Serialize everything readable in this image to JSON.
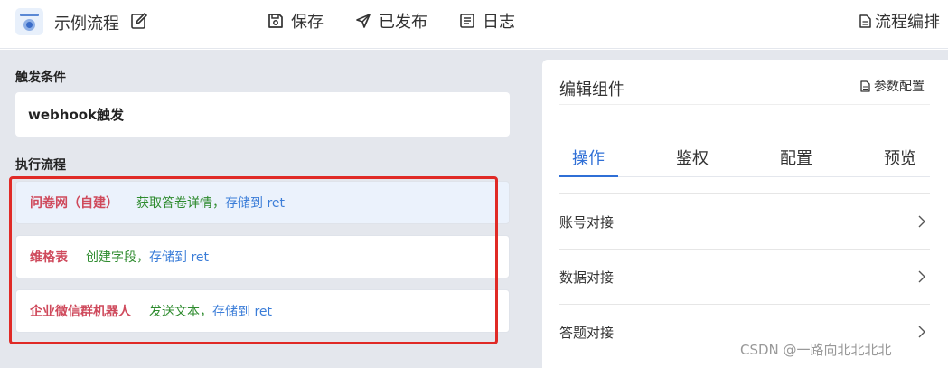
{
  "header": {
    "flow_name": "示例流程",
    "save_label": "保存",
    "publish_label": "已发布",
    "log_label": "日志",
    "arrange_label": "流程编排"
  },
  "left": {
    "trigger_title": "触发条件",
    "trigger_value": "webhook触发",
    "flow_title": "执行流程",
    "steps": [
      {
        "name": "问卷网（自建）",
        "action": "获取答卷详情，",
        "store": "存储到 ret"
      },
      {
        "name": "维格表",
        "action": "创建字段，",
        "store": "存储到 ret"
      },
      {
        "name": "企业微信群机器人",
        "action": "发送文本，",
        "store": "存储到 ret"
      }
    ]
  },
  "right": {
    "title": "编辑组件",
    "param_label": "参数配置",
    "tabs": [
      "操作",
      "鉴权",
      "配置",
      "预览"
    ],
    "rows": [
      "账号对接",
      "数据对接",
      "答题对接"
    ]
  },
  "watermark": "CSDN @一路向北北北北",
  "colors": {
    "accent": "#2f6fd6",
    "step_name": "#cf4a5c",
    "action": "#2e8b2e",
    "store": "#3b7dd8",
    "highlight": "#e02a26"
  }
}
